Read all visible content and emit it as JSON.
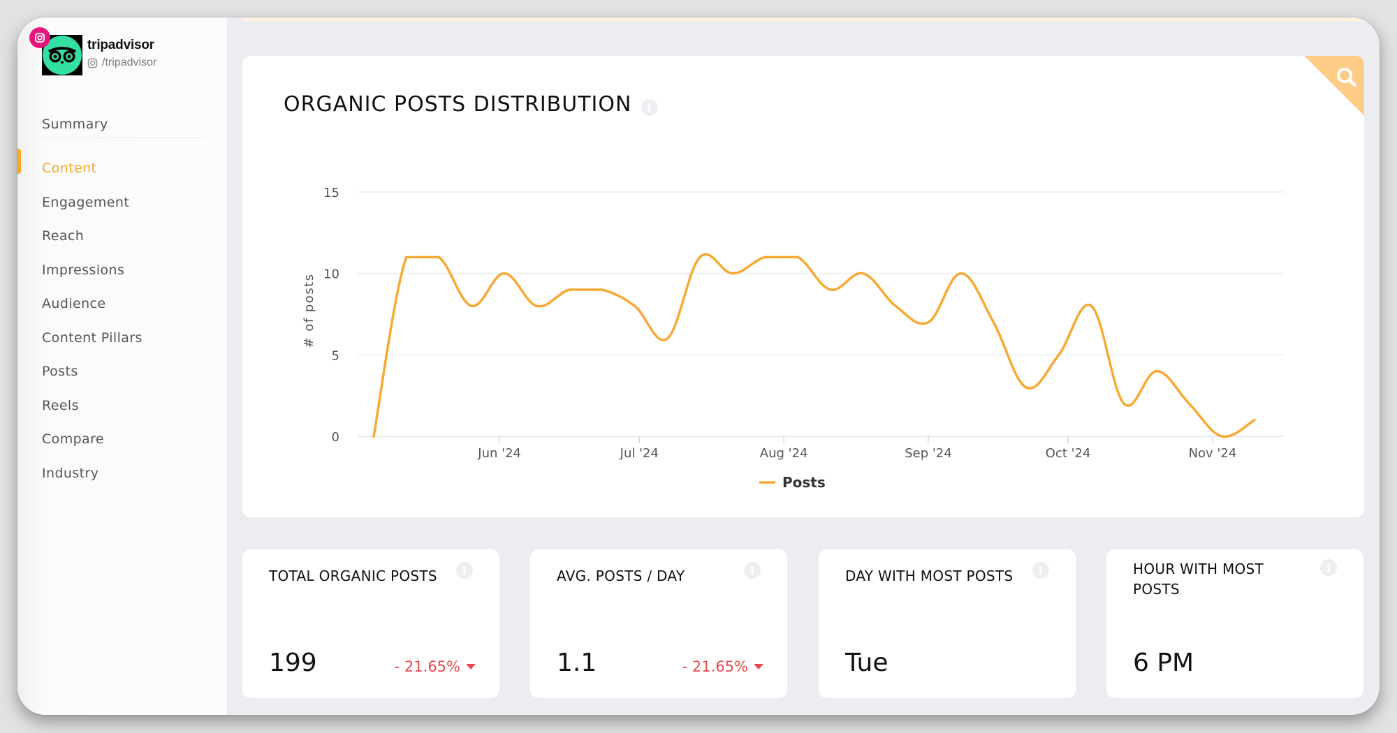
{
  "profile": {
    "name": "tripadvisor",
    "handle": "/tripadvisor",
    "platform": "instagram",
    "logo_color": "#34e0a1",
    "badge_color": "#e4167b"
  },
  "sidebar": {
    "items": [
      {
        "label": "Summary",
        "active": false
      },
      {
        "label": "Content",
        "active": true
      },
      {
        "label": "Engagement",
        "active": false
      },
      {
        "label": "Reach",
        "active": false
      },
      {
        "label": "Impressions",
        "active": false
      },
      {
        "label": "Audience",
        "active": false
      },
      {
        "label": "Content Pillars",
        "active": false
      },
      {
        "label": "Posts",
        "active": false
      },
      {
        "label": "Reels",
        "active": false
      },
      {
        "label": "Compare",
        "active": false
      },
      {
        "label": "Industry",
        "active": false
      }
    ],
    "accent_color": "#f5a623"
  },
  "chart_card": {
    "title": "ORGANIC POSTS DISTRIBUTION",
    "info_icon": "info-icon",
    "corner_icon": "search-icon"
  },
  "chart_data": {
    "type": "line",
    "title": "ORGANIC POSTS DISTRIBUTION",
    "xlabel": "",
    "ylabel": "# of posts",
    "ylim": [
      0,
      15
    ],
    "yticks": [
      0,
      5,
      10,
      15
    ],
    "grid": true,
    "x_start": "2024-05-05",
    "x_interval": "weekly",
    "xticks": [
      {
        "date": "2024-06-01",
        "label": "Jun '24"
      },
      {
        "date": "2024-07-01",
        "label": "Jul '24"
      },
      {
        "date": "2024-08-01",
        "label": "Aug '24"
      },
      {
        "date": "2024-09-01",
        "label": "Sep '24"
      },
      {
        "date": "2024-10-01",
        "label": "Oct '24"
      },
      {
        "date": "2024-11-01",
        "label": "Nov '24"
      }
    ],
    "x_domain": [
      "2024-05-05",
      "2024-11-10"
    ],
    "series": [
      {
        "name": "Posts",
        "color": "#f7a933",
        "values": [
          0,
          11,
          11,
          8,
          10,
          8,
          9,
          9,
          8,
          6,
          11,
          10,
          11,
          11,
          9,
          10,
          8,
          7,
          10,
          7,
          3,
          5,
          8,
          2,
          4,
          2,
          0,
          1
        ]
      }
    ],
    "legend": {
      "position": "bottom-center",
      "entries": [
        "Posts"
      ]
    }
  },
  "stats": [
    {
      "label": "TOTAL ORGANIC POSTS",
      "value": "199",
      "change": "- 21.65%",
      "trend": "down"
    },
    {
      "label": "AVG. POSTS / DAY",
      "value": "1.1",
      "change": "- 21.65%",
      "trend": "down"
    },
    {
      "label": "DAY WITH MOST POSTS",
      "value": "Tue",
      "change": null,
      "trend": null
    },
    {
      "label": "HOUR WITH MOST POSTS",
      "value": "6 PM",
      "change": null,
      "trend": null
    }
  ],
  "colors": {
    "negative": "#e5484d",
    "page_bg": "#ecedf1"
  }
}
